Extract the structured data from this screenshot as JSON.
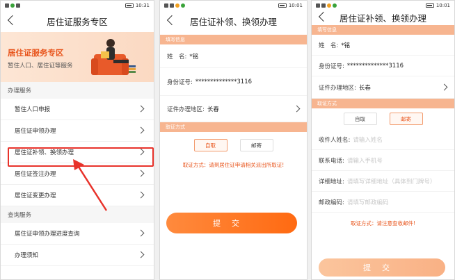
{
  "status": {
    "left_time": "10:31",
    "mid_time": "10:01",
    "right_time": "10:01"
  },
  "screen1": {
    "title": "居住证服务专区",
    "banner_title": "居住证服务专区",
    "banner_subtitle": "暂住人口、居住证等服务",
    "section1": "办理服务",
    "items1": [
      "暂住人口申报",
      "居住证申领办理",
      "居住证补领、换领办理",
      "居住证签注办理",
      "居住证变更办理"
    ],
    "section2": "查询服务",
    "items2": [
      "居住证申领办理进度查询",
      "办理须知"
    ]
  },
  "screen2": {
    "title": "居住证补领、换领办理",
    "fill_header": "填写信息",
    "name_label": "姓　名:",
    "name_value": "*铭",
    "id_label": "身份证号:",
    "id_value": "**************3116",
    "region_label": "证件办理地区:",
    "region_value": "长春",
    "method_header": "取证方式",
    "opt_self": "自取",
    "opt_mail": "邮寄",
    "note": "取证方式：请到居住证申请相关派出所取证!",
    "submit": "提交"
  },
  "screen3": {
    "title": "居住证补领、换领办理",
    "fill_header": "填写信息",
    "name_label": "姓　名:",
    "name_value": "*铭",
    "id_label": "身份证号:",
    "id_value": "**************3116",
    "region_label": "证件办理地区:",
    "region_value": "长春",
    "method_header": "取证方式",
    "opt_self": "自取",
    "opt_mail": "邮寄",
    "recv_label": "收件人姓名:",
    "recv_ph": "请输入姓名",
    "phone_label": "联系电话:",
    "phone_ph": "请输入手机号",
    "addr_label": "详细地址:",
    "addr_ph": "请填写详细地址（具体到门牌号）",
    "zip_label": "邮政编码:",
    "zip_ph": "请填写邮政编码",
    "note": "取证方式：请注意查收邮件!",
    "submit": "提交"
  },
  "colors": {
    "accent": "#e8541b",
    "highlight": "#e8322a",
    "header_bar": "#f7b590"
  }
}
